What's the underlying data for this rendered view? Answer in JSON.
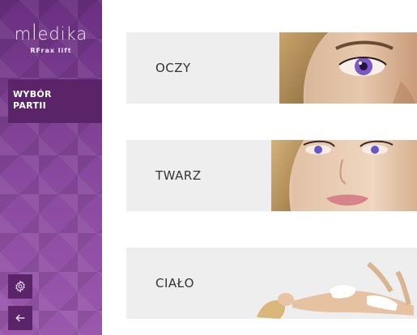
{
  "sidebar": {
    "logo_text": "mꟾedika",
    "logo_sub": "RFrax lift",
    "nav_active_label": "WYBÓR\nPARTII",
    "settings_icon": "gear-icon",
    "back_icon": "arrow-left-icon"
  },
  "cards": [
    {
      "label": "OCZY",
      "image": "eye-closeup-photo"
    },
    {
      "label": "TWARZ",
      "image": "face-closeup-photo"
    },
    {
      "label": "CIAŁO",
      "image": "reclining-woman-photo"
    }
  ],
  "colors": {
    "sidebar": "#7a3f8d",
    "sidebar_dark": "#5b2368",
    "card_bg": "#eeeeee",
    "text": "#333333"
  }
}
